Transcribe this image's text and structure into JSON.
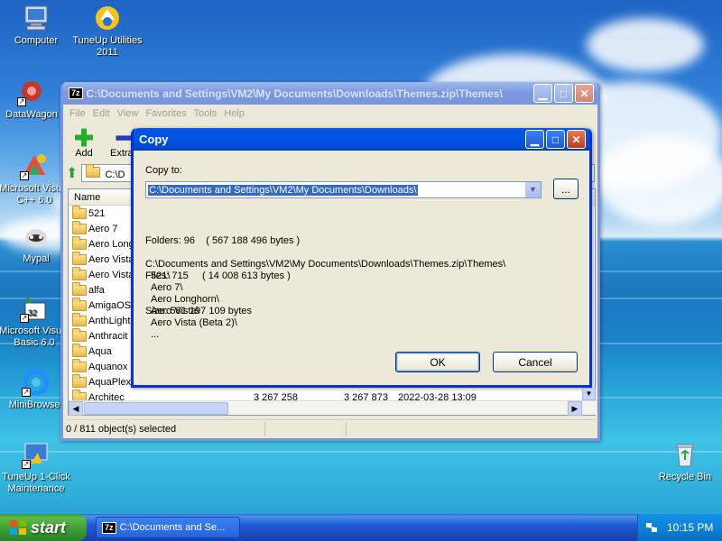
{
  "desktop": {
    "icons": [
      {
        "label": "Computer",
        "icon": "computer-icon"
      },
      {
        "label": "TuneUp Utilities 2011",
        "icon": "tuneup-icon"
      },
      {
        "label": "DataWagon",
        "icon": "datawagon-icon"
      },
      {
        "label": "Microsoft Visual C++ 6.0",
        "icon": "vcpp-icon"
      },
      {
        "label": "Mypal",
        "icon": "mypal-icon"
      },
      {
        "label": "Microsoft Visual Basic 6.0",
        "icon": "vb-icon"
      },
      {
        "label": "MiniBrowser",
        "icon": "minibrowser-icon"
      },
      {
        "label": "TuneUp 1-Click Maintenance",
        "icon": "tuneup-oneclick-icon"
      },
      {
        "label": "Recycle Bin",
        "icon": "recycle-bin-icon"
      }
    ]
  },
  "main_window": {
    "title": "C:\\Documents and Settings\\VM2\\My Documents\\Downloads\\Themes.zip\\Themes\\",
    "menu": [
      "File",
      "Edit",
      "View",
      "Favorites",
      "Tools",
      "Help"
    ],
    "toolbar": {
      "add": "Add",
      "extract": "Extract"
    },
    "address": "C:\\D",
    "column_name": "Name",
    "rows": [
      "521",
      "Aero 7",
      "Aero Longhorn",
      "Aero Vista",
      "Aero Vista",
      "alfa",
      "AmigaOS4",
      "AnthLight",
      "Anthracit",
      "Aqua",
      "Aquanox",
      "AquaPlex",
      "Architec"
    ],
    "last_row_extra": {
      "size": "3 267 258",
      "packed": "3 267 873",
      "modified": "2022-03-28 13:09"
    },
    "status": "0 / 811 object(s) selected"
  },
  "copy_dialog": {
    "title": "Copy",
    "copy_to_label": "Copy to:",
    "path": "C:\\Documents and Settings\\VM2\\My Documents\\Downloads\\",
    "browse": "...",
    "folders": "Folders: 96    ( 567 188 496 bytes )",
    "files": "Files: 715     ( 14 008 613 bytes )",
    "size": "Size: 581 197 109 bytes",
    "source": "C:\\Documents and Settings\\VM2\\My Documents\\Downloads\\Themes.zip\\Themes\\",
    "items": [
      "521\\",
      "Aero 7\\",
      "Aero Longhorn\\",
      "Aero Vista\\",
      "Aero Vista (Beta 2)\\",
      "..."
    ],
    "ok": "OK",
    "cancel": "Cancel"
  },
  "taskbar": {
    "start": "start",
    "task_label": "C:\\Documents and Se...",
    "clock": "10:15 PM"
  },
  "colors": {
    "title_active": "#0054e3",
    "title_inactive": "#7a96df",
    "window_face": "#ece9d8",
    "start_green": "#3a9b34",
    "selection": "#316ac5"
  }
}
